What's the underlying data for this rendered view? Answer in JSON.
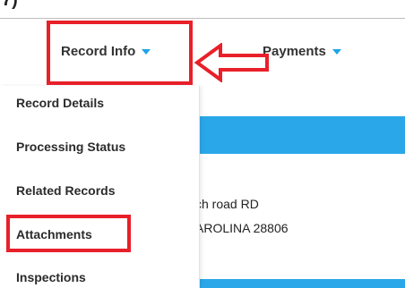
{
  "step_number": "7)",
  "nav": {
    "record_info_label": "Record Info",
    "payments_label": "Payments",
    "caret_color": "#1ea3ea"
  },
  "menu": {
    "items": [
      {
        "label": "Record Details"
      },
      {
        "label": "Processing Status"
      },
      {
        "label": "Related Records"
      },
      {
        "label": "Attachments"
      },
      {
        "label": "Inspections"
      }
    ]
  },
  "content": {
    "address_line_1": "ch road RD",
    "address_line_2": "AROLINA 28806",
    "banner_color": "#2aa7e8"
  },
  "annotation": {
    "highlight_color": "#e8202a",
    "arrow_icon": "left-arrow-outline"
  }
}
